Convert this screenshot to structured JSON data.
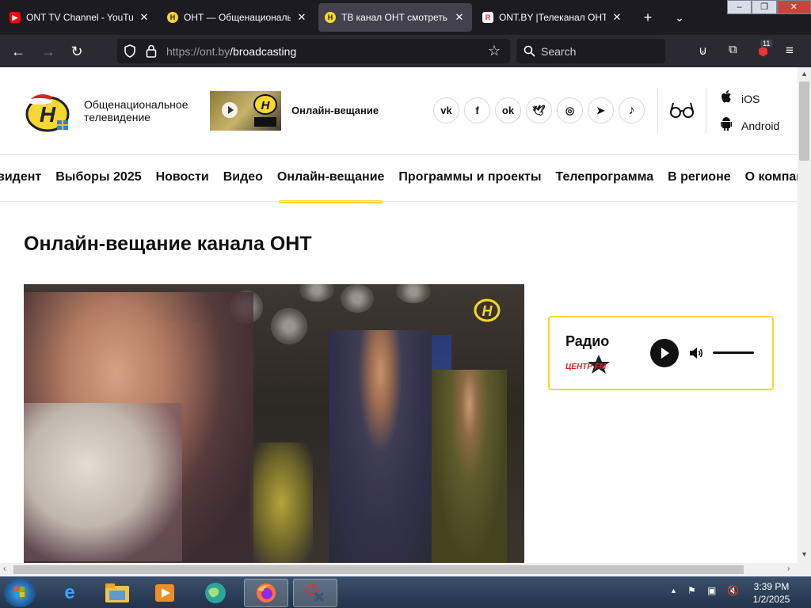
{
  "browser": {
    "tabs": [
      {
        "title": "ONT TV Channel - YouTube",
        "favicon": "youtube-icon",
        "color": "#ff0000"
      },
      {
        "title": "ОНТ — Общенациональ",
        "favicon": "ont-logo-icon",
        "color": "#f7d731"
      },
      {
        "title": "ТВ канал ОНТ смотреть | ",
        "favicon": "ont-logo-icon",
        "color": "#f7d731"
      },
      {
        "title": "ONT.BY |Телеканал ОНТ о",
        "favicon": "r-logo-icon",
        "color": "#e9243b"
      }
    ],
    "url_host": "https://ont.by",
    "url_path": "/broadcasting",
    "search_placeholder": "Search",
    "extension_badge": "11"
  },
  "site": {
    "slogan": "Общенациональное телевидение",
    "live_link": "Онлайн-вещание",
    "social": [
      "vk",
      "f",
      "ok",
      "twitter",
      "instagram",
      "telegram",
      "music"
    ],
    "apps": {
      "ios": "iOS",
      "android": "Android"
    },
    "menu": [
      {
        "label": "видент",
        "active": false
      },
      {
        "label": "Выборы 2025",
        "active": false
      },
      {
        "label": "Новости",
        "active": false
      },
      {
        "label": "Видео",
        "active": false
      },
      {
        "label": "Онлайн-вещание",
        "active": true
      },
      {
        "label": "Программы и проекты",
        "active": false
      },
      {
        "label": "Телепрограмма",
        "active": false
      },
      {
        "label": "В регионе",
        "active": false
      },
      {
        "label": "О компании",
        "active": false
      }
    ],
    "heading": "Онлайн-вещание канала ОНТ",
    "radio": {
      "title": "Радио",
      "station": "ЦЕНТР FM"
    },
    "accent": "#f7d731"
  },
  "taskbar": {
    "time": "3:39 PM",
    "date": "1/2/2025"
  }
}
